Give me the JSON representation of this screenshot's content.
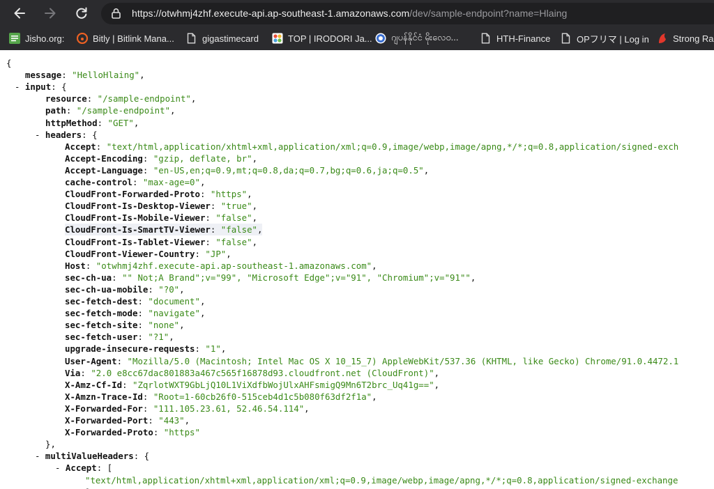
{
  "browser": {
    "url_host": "https://otwhmj4zhf.execute-api.ap-southeast-1.amazonaws.com",
    "url_path": "/dev/sample-endpoint?name=Hlaing",
    "bookmarks": [
      {
        "label": "Jisho.org:",
        "icon": "jisho-icon",
        "color": "#56a64b"
      },
      {
        "label": "Bitly | Bitlink Mana...",
        "icon": "bitly-icon",
        "color": "#ee6123"
      },
      {
        "label": "gigastimecard",
        "icon": "page-icon",
        "color": "#d9d9d9"
      },
      {
        "label": "TOP | IRODORI Ja...",
        "icon": "irodori-icon",
        "color": "#e94e3c"
      },
      {
        "label": "ဂျပန်နိုင်ငံ မိုးလေဝ...",
        "icon": "globe-icon",
        "color": "#3b6fd1"
      },
      {
        "label": "HTH-Finance",
        "icon": "page-icon",
        "color": "#d9d9d9"
      },
      {
        "label": "OPフリマ | Log in",
        "icon": "page-icon",
        "color": "#d9d9d9"
      },
      {
        "label": "Strong Ran",
        "icon": "strong-icon",
        "color": "#e2372b"
      }
    ]
  },
  "json_lines": [
    {
      "indent": 0,
      "prefix": "",
      "open": "{"
    },
    {
      "indent": 1,
      "prefix": "",
      "key": "message",
      "str": "\"HelloHlaing\"",
      "post": ","
    },
    {
      "indent": 0,
      "prefix": "- ",
      "key": "input",
      "open": "{"
    },
    {
      "indent": 2,
      "prefix": "",
      "key": "resource",
      "str": "\"/sample-endpoint\"",
      "post": ","
    },
    {
      "indent": 2,
      "prefix": "",
      "key": "path",
      "str": "\"/sample-endpoint\"",
      "post": ","
    },
    {
      "indent": 2,
      "prefix": "",
      "key": "httpMethod",
      "str": "\"GET\"",
      "post": ","
    },
    {
      "indent": 1,
      "prefix": "- ",
      "key": "headers",
      "open": "{"
    },
    {
      "indent": 3,
      "prefix": "",
      "key": "Accept",
      "str": "\"text/html,application/xhtml+xml,application/xml;q=0.9,image/webp,image/apng,*/*;q=0.8,application/signed-exch",
      "post": ""
    },
    {
      "indent": 3,
      "prefix": "",
      "key": "Accept-Encoding",
      "str": "\"gzip, deflate, br\"",
      "post": ","
    },
    {
      "indent": 3,
      "prefix": "",
      "key": "Accept-Language",
      "str": "\"en-US,en;q=0.9,mt;q=0.8,da;q=0.7,bg;q=0.6,ja;q=0.5\"",
      "post": ","
    },
    {
      "indent": 3,
      "prefix": "",
      "key": "cache-control",
      "str": "\"max-age=0\"",
      "post": ","
    },
    {
      "indent": 3,
      "prefix": "",
      "key": "CloudFront-Forwarded-Proto",
      "str": "\"https\"",
      "post": ","
    },
    {
      "indent": 3,
      "prefix": "",
      "key": "CloudFront-Is-Desktop-Viewer",
      "str": "\"true\"",
      "post": ","
    },
    {
      "indent": 3,
      "prefix": "",
      "key": "CloudFront-Is-Mobile-Viewer",
      "str": "\"false\"",
      "post": ","
    },
    {
      "indent": 3,
      "prefix": "",
      "key": "CloudFront-Is-SmartTV-Viewer",
      "str": "\"false\"",
      "post": ",",
      "hl": true
    },
    {
      "indent": 3,
      "prefix": "",
      "key": "CloudFront-Is-Tablet-Viewer",
      "str": "\"false\"",
      "post": ","
    },
    {
      "indent": 3,
      "prefix": "",
      "key": "CloudFront-Viewer-Country",
      "str": "\"JP\"",
      "post": ","
    },
    {
      "indent": 3,
      "prefix": "",
      "key": "Host",
      "str": "\"otwhmj4zhf.execute-api.ap-southeast-1.amazonaws.com\"",
      "post": ","
    },
    {
      "indent": 3,
      "prefix": "",
      "key": "sec-ch-ua",
      "str": "\"\" Not;A Brand\";v=\"99\", \"Microsoft Edge\";v=\"91\", \"Chromium\";v=\"91\"\"",
      "post": ","
    },
    {
      "indent": 3,
      "prefix": "",
      "key": "sec-ch-ua-mobile",
      "str": "\"?0\"",
      "post": ","
    },
    {
      "indent": 3,
      "prefix": "",
      "key": "sec-fetch-dest",
      "str": "\"document\"",
      "post": ","
    },
    {
      "indent": 3,
      "prefix": "",
      "key": "sec-fetch-mode",
      "str": "\"navigate\"",
      "post": ","
    },
    {
      "indent": 3,
      "prefix": "",
      "key": "sec-fetch-site",
      "str": "\"none\"",
      "post": ","
    },
    {
      "indent": 3,
      "prefix": "",
      "key": "sec-fetch-user",
      "str": "\"?1\"",
      "post": ","
    },
    {
      "indent": 3,
      "prefix": "",
      "key": "upgrade-insecure-requests",
      "str": "\"1\"",
      "post": ","
    },
    {
      "indent": 3,
      "prefix": "",
      "key": "User-Agent",
      "str": "\"Mozilla/5.0 (Macintosh; Intel Mac OS X 10_15_7) AppleWebKit/537.36 (KHTML, like Gecko) Chrome/91.0.4472.1",
      "post": ""
    },
    {
      "indent": 3,
      "prefix": "",
      "key": "Via",
      "str": "\"2.0 e8cc67dac801883a467c565f16878d93.cloudfront.net (CloudFront)\"",
      "post": ","
    },
    {
      "indent": 3,
      "prefix": "",
      "key": "X-Amz-Cf-Id",
      "str": "\"ZqrlotWXT9GbLjQ10L1ViXdfbWojUlxAHFsmigQ9Mn6T2brc_Uq41g==\"",
      "post": ","
    },
    {
      "indent": 3,
      "prefix": "",
      "key": "X-Amzn-Trace-Id",
      "str": "\"Root=1-60cb26f0-515ceb4d1c5b080f63df2f1a\"",
      "post": ","
    },
    {
      "indent": 3,
      "prefix": "",
      "key": "X-Forwarded-For",
      "str": "\"111.105.23.61, 52.46.54.114\"",
      "post": ","
    },
    {
      "indent": 3,
      "prefix": "",
      "key": "X-Forwarded-Port",
      "str": "\"443\"",
      "post": ","
    },
    {
      "indent": 3,
      "prefix": "",
      "key": "X-Forwarded-Proto",
      "str": "\"https\"",
      "post": ""
    },
    {
      "indent": 2,
      "prefix": "",
      "close": "},"
    },
    {
      "indent": 1,
      "prefix": "- ",
      "key": "multiValueHeaders",
      "open": "{"
    },
    {
      "indent": 2,
      "prefix": "- ",
      "key": "Accept",
      "open": "["
    },
    {
      "indent": 4,
      "prefix": "",
      "str": "\"text/html,application/xhtml+xml,application/xml;q=0.9,image/webp,image/apng,*/*;q=0.8,application/signed-exchange",
      "post": ""
    },
    {
      "indent": 4,
      "prefix": "",
      "close": "]"
    }
  ]
}
